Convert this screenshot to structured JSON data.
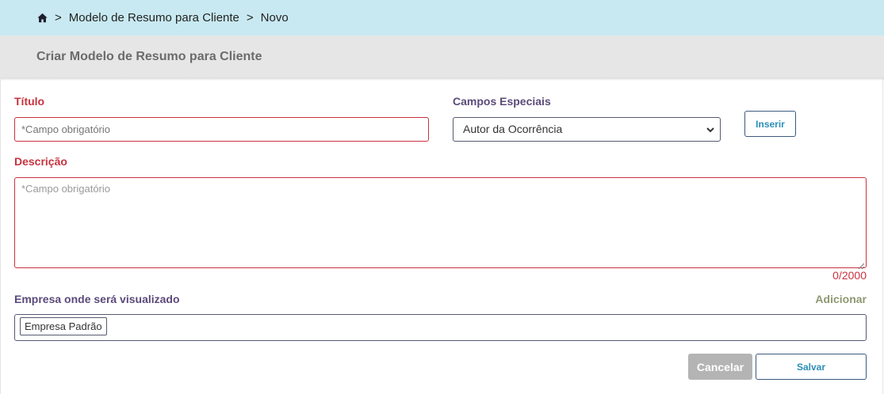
{
  "breadcrumb": {
    "home_icon": "home-icon",
    "separator": ">",
    "items": [
      "Modelo de Resumo para Cliente",
      "Novo"
    ]
  },
  "page": {
    "title": "Criar Modelo de Resumo para Cliente"
  },
  "form": {
    "title": {
      "label": "Título",
      "value": "",
      "placeholder": "*Campo obrigatório"
    },
    "special_fields": {
      "label": "Campos Especiais",
      "selected": "Autor da Ocorrência",
      "insert_label": "Inserir"
    },
    "description": {
      "label": "Descrição",
      "value": "",
      "placeholder": "*Campo obrigatório",
      "counter": "0/2000"
    },
    "company": {
      "label": "Empresa onde será visualizado",
      "add_label": "Adicionar",
      "tags": [
        "Empresa Padrão"
      ]
    }
  },
  "actions": {
    "cancel_label": "Cancelar",
    "save_label": "Salvar"
  },
  "colors": {
    "breadcrumb_bg": "#c8e9f1",
    "title_bar_bg": "#e6e6e6",
    "required": "#c8323f",
    "label": "#5b4a7a",
    "accent": "#2a8fb8"
  }
}
